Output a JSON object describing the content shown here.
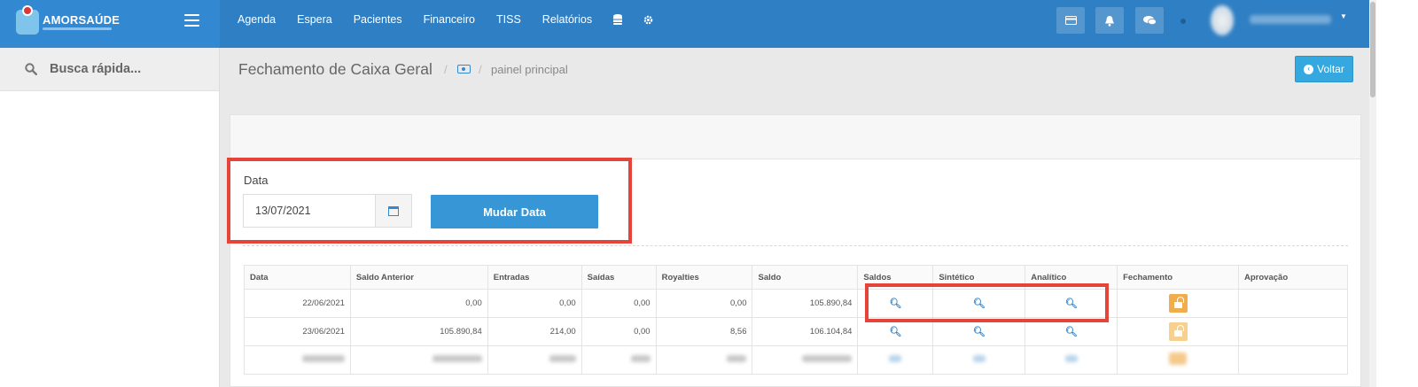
{
  "brand": {
    "name": "AMORSAÚDE"
  },
  "topnav": {
    "items": [
      "Agenda",
      "Espera",
      "Pacientes",
      "Financeiro",
      "TISS",
      "Relatórios"
    ],
    "icons": [
      "database-icon",
      "gear-icon"
    ]
  },
  "topbar_actions": [
    "card-icon",
    "bell-icon",
    "chat-icon"
  ],
  "sidebar": {
    "search_label": "Busca rápida..."
  },
  "header": {
    "title": "Fechamento de Caixa Geral",
    "breadcrumb_current": "painel principal",
    "back_label": "Voltar"
  },
  "filter": {
    "date_label": "Data",
    "date_value": "13/07/2021",
    "submit_label": "Mudar Data"
  },
  "table": {
    "columns": [
      "Data",
      "Saldo Anterior",
      "Entradas",
      "Saídas",
      "Royalties",
      "Saldo",
      "Saldos",
      "Sintético",
      "Analítico",
      "Fechamento",
      "Aprovação"
    ],
    "rows": [
      {
        "data": "22/06/2021",
        "saldo_anterior": "0,00",
        "entradas": "0,00",
        "saidas": "0,00",
        "royalties": "0,00",
        "saldo": "105.890,84"
      },
      {
        "data": "23/06/2021",
        "saldo_anterior": "105.890,84",
        "entradas": "214,00",
        "saidas": "0,00",
        "royalties": "8,56",
        "saldo": "106.104,84"
      }
    ]
  },
  "colors": {
    "topbar": "#2f7fc4",
    "primary_button": "#3796d6",
    "lock_button": "#f0ad4e",
    "highlight": "#e4443a"
  }
}
